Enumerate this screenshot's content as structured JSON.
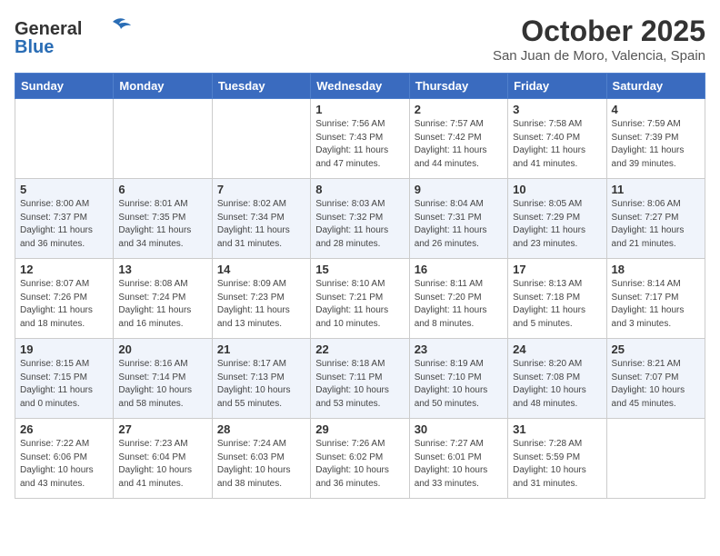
{
  "header": {
    "logo": {
      "general": "General",
      "blue": "Blue"
    },
    "title": "October 2025",
    "location": "San Juan de Moro, Valencia, Spain"
  },
  "days_of_week": [
    "Sunday",
    "Monday",
    "Tuesday",
    "Wednesday",
    "Thursday",
    "Friday",
    "Saturday"
  ],
  "weeks": [
    [
      {
        "day": "",
        "info": ""
      },
      {
        "day": "",
        "info": ""
      },
      {
        "day": "",
        "info": ""
      },
      {
        "day": "1",
        "info": "Sunrise: 7:56 AM\nSunset: 7:43 PM\nDaylight: 11 hours\nand 47 minutes."
      },
      {
        "day": "2",
        "info": "Sunrise: 7:57 AM\nSunset: 7:42 PM\nDaylight: 11 hours\nand 44 minutes."
      },
      {
        "day": "3",
        "info": "Sunrise: 7:58 AM\nSunset: 7:40 PM\nDaylight: 11 hours\nand 41 minutes."
      },
      {
        "day": "4",
        "info": "Sunrise: 7:59 AM\nSunset: 7:39 PM\nDaylight: 11 hours\nand 39 minutes."
      }
    ],
    [
      {
        "day": "5",
        "info": "Sunrise: 8:00 AM\nSunset: 7:37 PM\nDaylight: 11 hours\nand 36 minutes."
      },
      {
        "day": "6",
        "info": "Sunrise: 8:01 AM\nSunset: 7:35 PM\nDaylight: 11 hours\nand 34 minutes."
      },
      {
        "day": "7",
        "info": "Sunrise: 8:02 AM\nSunset: 7:34 PM\nDaylight: 11 hours\nand 31 minutes."
      },
      {
        "day": "8",
        "info": "Sunrise: 8:03 AM\nSunset: 7:32 PM\nDaylight: 11 hours\nand 28 minutes."
      },
      {
        "day": "9",
        "info": "Sunrise: 8:04 AM\nSunset: 7:31 PM\nDaylight: 11 hours\nand 26 minutes."
      },
      {
        "day": "10",
        "info": "Sunrise: 8:05 AM\nSunset: 7:29 PM\nDaylight: 11 hours\nand 23 minutes."
      },
      {
        "day": "11",
        "info": "Sunrise: 8:06 AM\nSunset: 7:27 PM\nDaylight: 11 hours\nand 21 minutes."
      }
    ],
    [
      {
        "day": "12",
        "info": "Sunrise: 8:07 AM\nSunset: 7:26 PM\nDaylight: 11 hours\nand 18 minutes."
      },
      {
        "day": "13",
        "info": "Sunrise: 8:08 AM\nSunset: 7:24 PM\nDaylight: 11 hours\nand 16 minutes."
      },
      {
        "day": "14",
        "info": "Sunrise: 8:09 AM\nSunset: 7:23 PM\nDaylight: 11 hours\nand 13 minutes."
      },
      {
        "day": "15",
        "info": "Sunrise: 8:10 AM\nSunset: 7:21 PM\nDaylight: 11 hours\nand 10 minutes."
      },
      {
        "day": "16",
        "info": "Sunrise: 8:11 AM\nSunset: 7:20 PM\nDaylight: 11 hours\nand 8 minutes."
      },
      {
        "day": "17",
        "info": "Sunrise: 8:13 AM\nSunset: 7:18 PM\nDaylight: 11 hours\nand 5 minutes."
      },
      {
        "day": "18",
        "info": "Sunrise: 8:14 AM\nSunset: 7:17 PM\nDaylight: 11 hours\nand 3 minutes."
      }
    ],
    [
      {
        "day": "19",
        "info": "Sunrise: 8:15 AM\nSunset: 7:15 PM\nDaylight: 11 hours\nand 0 minutes."
      },
      {
        "day": "20",
        "info": "Sunrise: 8:16 AM\nSunset: 7:14 PM\nDaylight: 10 hours\nand 58 minutes."
      },
      {
        "day": "21",
        "info": "Sunrise: 8:17 AM\nSunset: 7:13 PM\nDaylight: 10 hours\nand 55 minutes."
      },
      {
        "day": "22",
        "info": "Sunrise: 8:18 AM\nSunset: 7:11 PM\nDaylight: 10 hours\nand 53 minutes."
      },
      {
        "day": "23",
        "info": "Sunrise: 8:19 AM\nSunset: 7:10 PM\nDaylight: 10 hours\nand 50 minutes."
      },
      {
        "day": "24",
        "info": "Sunrise: 8:20 AM\nSunset: 7:08 PM\nDaylight: 10 hours\nand 48 minutes."
      },
      {
        "day": "25",
        "info": "Sunrise: 8:21 AM\nSunset: 7:07 PM\nDaylight: 10 hours\nand 45 minutes."
      }
    ],
    [
      {
        "day": "26",
        "info": "Sunrise: 7:22 AM\nSunset: 6:06 PM\nDaylight: 10 hours\nand 43 minutes."
      },
      {
        "day": "27",
        "info": "Sunrise: 7:23 AM\nSunset: 6:04 PM\nDaylight: 10 hours\nand 41 minutes."
      },
      {
        "day": "28",
        "info": "Sunrise: 7:24 AM\nSunset: 6:03 PM\nDaylight: 10 hours\nand 38 minutes."
      },
      {
        "day": "29",
        "info": "Sunrise: 7:26 AM\nSunset: 6:02 PM\nDaylight: 10 hours\nand 36 minutes."
      },
      {
        "day": "30",
        "info": "Sunrise: 7:27 AM\nSunset: 6:01 PM\nDaylight: 10 hours\nand 33 minutes."
      },
      {
        "day": "31",
        "info": "Sunrise: 7:28 AM\nSunset: 5:59 PM\nDaylight: 10 hours\nand 31 minutes."
      },
      {
        "day": "",
        "info": ""
      }
    ]
  ]
}
